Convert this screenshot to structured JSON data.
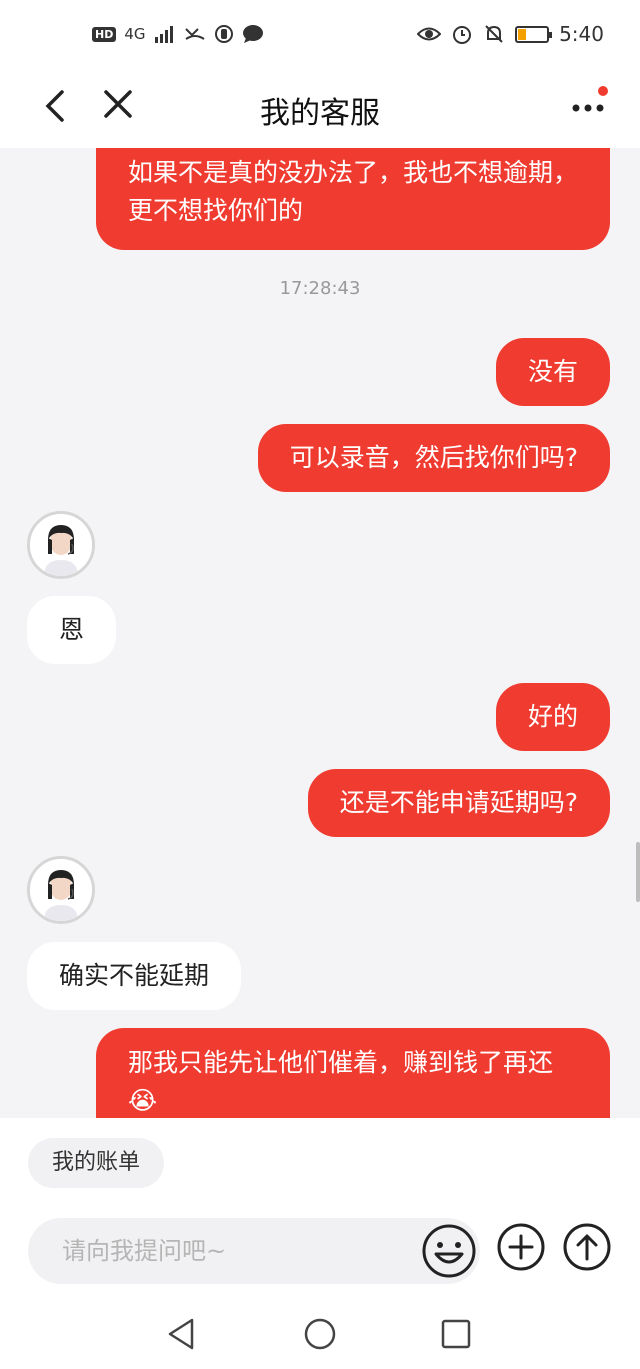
{
  "status_bar": {
    "left_text": "HD 4G",
    "signal": "4G",
    "time": "5:40",
    "battery_level": 0.15
  },
  "nav": {
    "title": "我的客服",
    "back_icon": "chevron-left-icon",
    "close_icon": "close-icon",
    "more_icon": "more-dots-icon"
  },
  "chat": {
    "messages": [
      {
        "side": "out",
        "text": "如果不是真的没办法了，我也不想逾期，更不想找你们的"
      },
      {
        "side": "time",
        "text": "17:28:43"
      },
      {
        "side": "out",
        "text": "没有"
      },
      {
        "side": "out",
        "text": "可以录音，然后找你们吗?"
      },
      {
        "side": "in",
        "text": "恩"
      },
      {
        "side": "out",
        "text": "好的"
      },
      {
        "side": "out",
        "text": "还是不能申请延期吗?"
      },
      {
        "side": "in",
        "text": "确实不能延期"
      },
      {
        "side": "out",
        "text": "那我只能先让他们催着，赚到钱了再还😭"
      }
    ]
  },
  "shortcut": {
    "label": "我的账单"
  },
  "input": {
    "placeholder": "请向我提问吧~"
  },
  "colors": {
    "accent": "#f03b30",
    "background": "#f4f4f6"
  }
}
